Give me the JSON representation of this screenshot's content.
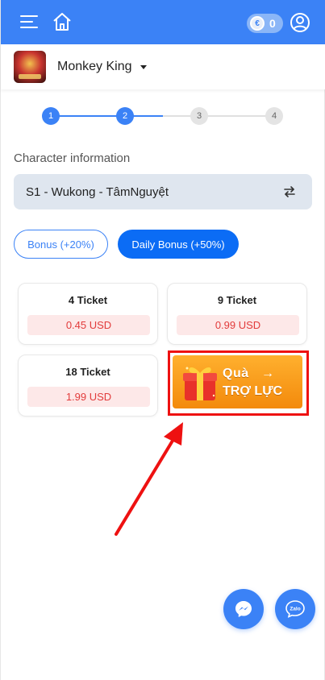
{
  "header": {
    "coin_count": "0",
    "coin_glyph": "€",
    "accent": "#3b82f6"
  },
  "game": {
    "name": "Monkey King"
  },
  "stepper": {
    "steps": [
      "1",
      "2",
      "3",
      "4"
    ],
    "current": 2
  },
  "character": {
    "label": "Character information",
    "selected": "S1 - Wukong - TâmNguyệt"
  },
  "bonus_tabs": [
    {
      "label": "Bonus (+20%)",
      "active": false
    },
    {
      "label": "Daily Bonus (+50%)",
      "active": true
    }
  ],
  "tickets": [
    {
      "title": "4 Ticket",
      "price": "0.45 USD"
    },
    {
      "title": "9 Ticket",
      "price": "0.99 USD"
    },
    {
      "title": "18 Ticket",
      "price": "1.99 USD"
    }
  ],
  "promo": {
    "line1": "Quà",
    "arrow": "→",
    "line2": "TRỢ LỰC"
  },
  "fabs": {
    "zalo_label": "Zalo"
  },
  "colors": {
    "primary": "#3b82f6",
    "price_red": "#e23b3b",
    "promo_orange": "#f38a0c",
    "highlight_red": "#ee1111"
  }
}
